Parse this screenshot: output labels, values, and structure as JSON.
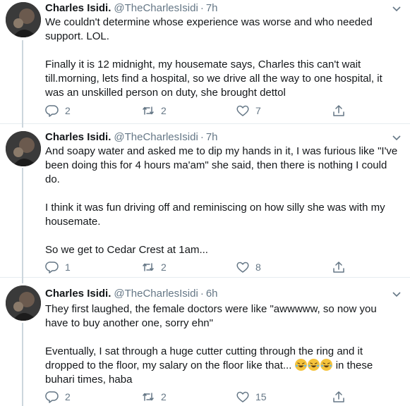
{
  "tweets": [
    {
      "name": "Charles Isidi.",
      "handle": "@TheCharlesIsidi",
      "separator": "·",
      "time": "7h",
      "text": "We couldn't determine whose experience was worse and who needed support. LOL.\n\nFinally it is 12 midnight, my housemate says, Charles this can't wait till.morning, lets find a hospital, so we drive all the way to one hospital, it was an unskilled person on duty, she brought dettol",
      "replies": "2",
      "retweets": "2",
      "likes": "7"
    },
    {
      "name": "Charles Isidi.",
      "handle": "@TheCharlesIsidi",
      "separator": "·",
      "time": "7h",
      "text": "And soapy water and asked me to dip my hands in it, I was furious like \"I've been doing this for 4 hours ma'am\" she said, then there is nothing I could do.\n\nI think it was fun driving off and reminiscing on how silly she was with my housemate.\n\nSo we get to Cedar Crest at 1am...",
      "replies": "1",
      "retweets": "2",
      "likes": "8"
    },
    {
      "name": "Charles Isidi.",
      "handle": "@TheCharlesIsidi",
      "separator": "·",
      "time": "6h",
      "text_before_emoji": "They first laughed, the female doctors were like \"awwwww, so now you have to buy another one, sorry ehn\"\n\nEventually, I sat through a huge cutter cutting through the ring and it dropped to the floor, my salary on the floor like that... ",
      "emoji": "rolling-on-floor-laughing-emoji",
      "text_after_emoji": " in these buhari times, haba",
      "replies": "2",
      "retweets": "2",
      "likes": "15"
    }
  ],
  "colors": {
    "text": "#14171a",
    "secondary": "#657786",
    "divider": "#e6ecf0",
    "thread_line": "#ccd6dd",
    "emoji": "#f5c33b"
  },
  "icons": [
    "reply-icon",
    "retweet-icon",
    "like-icon",
    "share-icon",
    "chevron-down-icon"
  ]
}
